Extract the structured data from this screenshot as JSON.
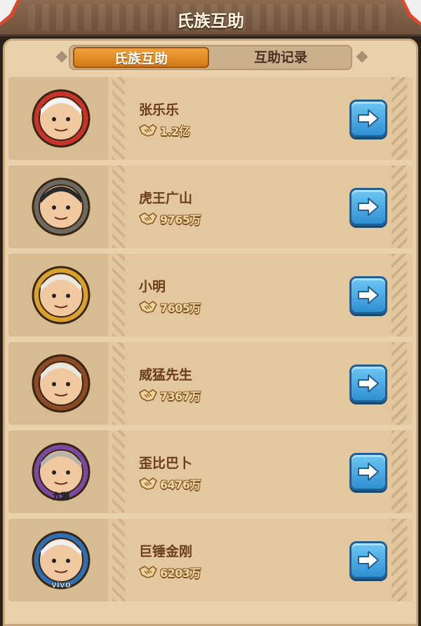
{
  "header": {
    "title": "氏族互助"
  },
  "tabs": [
    {
      "label": "氏族互助",
      "active": true
    },
    {
      "label": "互助记录",
      "active": false
    }
  ],
  "members": [
    {
      "name": "张乐乐",
      "power": "1.2亿",
      "avatar_badge": "",
      "frame": "red",
      "avatar_icon": "avatar-hooded-warrior-icon"
    },
    {
      "name": "虎王广山",
      "power": "9765万",
      "avatar_badge": "",
      "frame": "gray",
      "avatar_icon": "avatar-tribal-woman-icon"
    },
    {
      "name": "小明",
      "power": "7605万",
      "avatar_badge": "",
      "frame": "gold",
      "avatar_icon": "avatar-skull-mask-icon"
    },
    {
      "name": "威猛先生",
      "power": "7367万",
      "avatar_badge": "",
      "frame": "brown",
      "avatar_icon": "avatar-skull-mask-icon"
    },
    {
      "name": "歪比巴卜",
      "power": "6476万",
      "avatar_badge": "九游",
      "frame": "purple",
      "avatar_icon": "avatar-bearded-elder-icon"
    },
    {
      "name": "巨锤金刚",
      "power": "6203万",
      "avatar_badge": "vivo",
      "frame": "blue",
      "avatar_icon": "avatar-box-head-icon"
    }
  ],
  "icons": {
    "power": "handshake-icon",
    "action": "arrow-right-icon"
  },
  "colors": {
    "accent": "#e08a24",
    "button": "#3da0dd",
    "panel": "#e9d2ab"
  }
}
